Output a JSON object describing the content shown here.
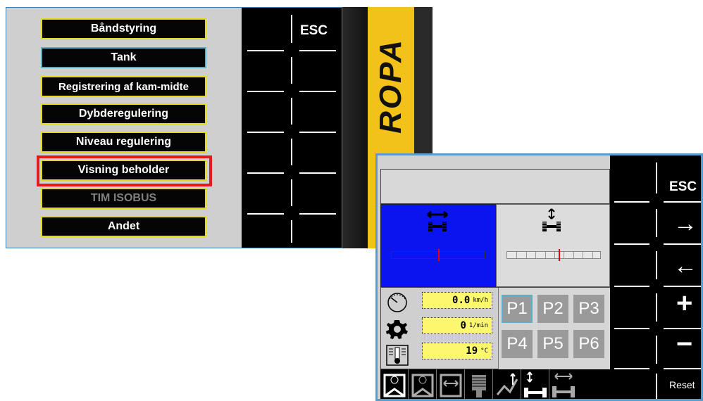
{
  "screen1": {
    "menu": [
      {
        "label": "Båndstyring",
        "state": "normal"
      },
      {
        "label": "Tank",
        "state": "selected"
      },
      {
        "label": "Registrering af kam-midte",
        "state": "normal"
      },
      {
        "label": "Dybderegulering",
        "state": "normal"
      },
      {
        "label": "Niveau regulering",
        "state": "normal"
      },
      {
        "label": "Visning beholder",
        "state": "highlighted"
      },
      {
        "label": "TIM ISOBUS",
        "state": "disabled"
      },
      {
        "label": "Andet",
        "state": "normal"
      }
    ],
    "softkey_esc": "ESC"
  },
  "brand_panel": {
    "logo_text": "ROPA"
  },
  "screen2": {
    "softkeys": {
      "esc": "ESC",
      "right": "→",
      "left": "←",
      "plus": "+",
      "minus": "−",
      "reset": "Reset"
    },
    "readouts": {
      "speed": {
        "value": "0.0",
        "unit": "km/h"
      },
      "rpm": {
        "value": "0",
        "unit": "1/min"
      },
      "temperature": {
        "value": "19",
        "unit": "°C"
      }
    },
    "presets": [
      "P1",
      "P2",
      "P3",
      "P4",
      "P5",
      "P6"
    ],
    "selected_preset": "P1",
    "side_shift_position": 0.5,
    "height_position": 0.55
  },
  "colors": {
    "menu_border": "#e6d81a",
    "highlight": "#e11a1a",
    "active_panel": "#0a14ee",
    "readout_bg": "#fbf76e",
    "brand_yellow": "#f2c21b"
  }
}
